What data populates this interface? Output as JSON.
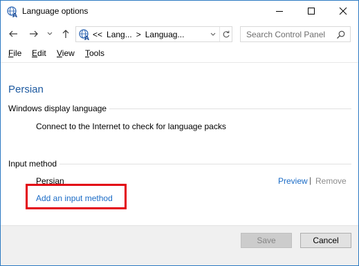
{
  "window": {
    "title": "Language options",
    "controls": {
      "minimize": "minimize",
      "maximize": "maximize",
      "close": "close"
    }
  },
  "address": {
    "prefix": "<<",
    "crumbs": [
      "Lang...",
      "Languag..."
    ],
    "separator": ">"
  },
  "search": {
    "placeholder": "Search Control Panel"
  },
  "menu": {
    "items": [
      {
        "label": "File",
        "mnemonic": "F",
        "rest": "ile"
      },
      {
        "label": "Edit",
        "mnemonic": "E",
        "rest": "dit"
      },
      {
        "label": "View",
        "mnemonic": "V",
        "rest": "iew"
      },
      {
        "label": "Tools",
        "mnemonic": "T",
        "rest": "ools"
      }
    ]
  },
  "content": {
    "language_title": "Persian",
    "display_section": {
      "header": "Windows display language",
      "message": "Connect to the Internet to check for language packs"
    },
    "input_section": {
      "header": "Input method",
      "method_name": "Persian",
      "preview_link": "Preview",
      "link_separator": "|",
      "remove_link": "Remove",
      "add_link": "Add an input method"
    }
  },
  "footer": {
    "save_label": "Save",
    "cancel_label": "Cancel"
  },
  "colors": {
    "link": "#1a6bc6",
    "title_blue": "#1e5aa0",
    "highlight_red": "#e3000f",
    "disabled_text": "#8c8c8c"
  },
  "icons": {
    "app": "language-globe-icon",
    "back": "arrow-left-icon",
    "forward": "arrow-right-icon",
    "up": "arrow-up-icon",
    "refresh": "refresh-icon",
    "search": "search-icon"
  }
}
